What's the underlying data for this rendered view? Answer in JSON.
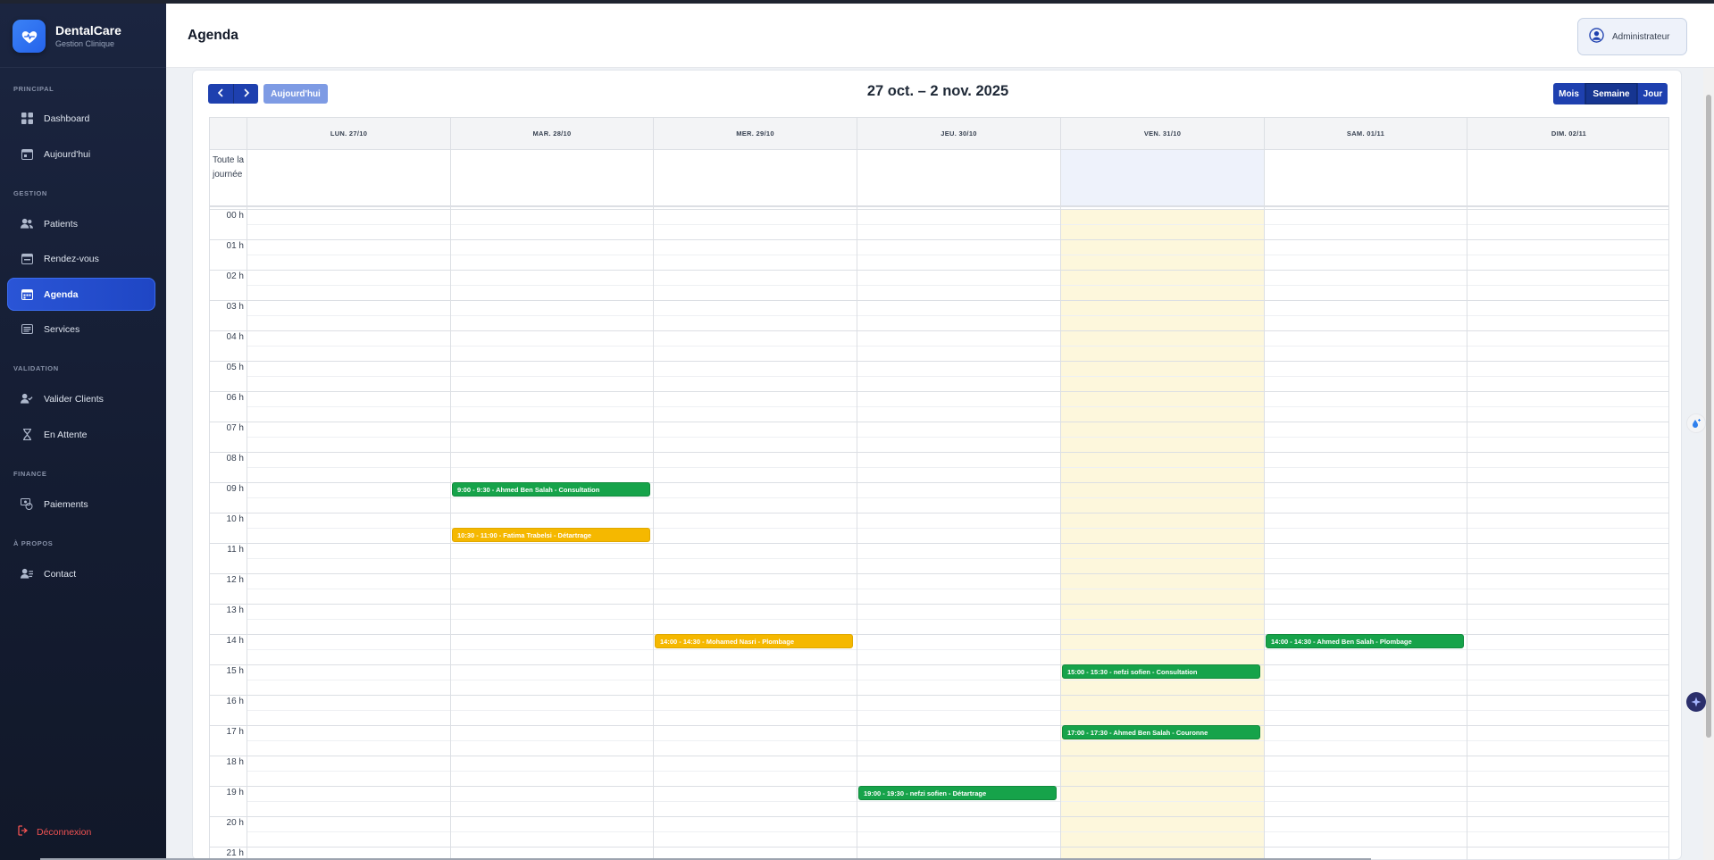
{
  "app": {
    "name": "DentalCare",
    "subtitle": "Gestion Clinique"
  },
  "sidebar": {
    "sections": [
      {
        "label": "PRINCIPAL"
      },
      {
        "label": "GESTION"
      },
      {
        "label": "VALIDATION"
      },
      {
        "label": "FINANCE"
      },
      {
        "label": "À PROPOS"
      }
    ],
    "items": [
      {
        "label": "Dashboard",
        "icon": "grid-icon"
      },
      {
        "label": "Aujourd'hui",
        "icon": "calendar-today-icon"
      },
      {
        "label": "Patients",
        "icon": "users-icon"
      },
      {
        "label": "Rendez-vous",
        "icon": "calendar-check-icon"
      },
      {
        "label": "Agenda",
        "icon": "agenda-icon",
        "active": true
      },
      {
        "label": "Services",
        "icon": "list-icon"
      },
      {
        "label": "Valider Clients",
        "icon": "user-check-icon"
      },
      {
        "label": "En Attente",
        "icon": "hourglass-icon"
      },
      {
        "label": "Paiements",
        "icon": "money-icon"
      },
      {
        "label": "Contact",
        "icon": "contact-icon"
      }
    ],
    "logout_label": "Déconnexion"
  },
  "header": {
    "title": "Agenda",
    "user_label": "Administrateur"
  },
  "calendar": {
    "range_title": "27 oct. – 2 nov. 2025",
    "today_label": "Aujourd'hui",
    "views": [
      {
        "label": "Mois"
      },
      {
        "label": "Semaine",
        "active": true
      },
      {
        "label": "Jour"
      }
    ],
    "allday_label": "Toute la journée",
    "days": [
      {
        "label": "LUN. 27/10"
      },
      {
        "label": "MAR. 28/10"
      },
      {
        "label": "MER. 29/10"
      },
      {
        "label": "JEU. 30/10"
      },
      {
        "label": "VEN. 31/10",
        "today": true
      },
      {
        "label": "SAM. 01/11"
      },
      {
        "label": "DIM. 02/11"
      }
    ],
    "hours": [
      "00 h",
      "01 h",
      "02 h",
      "03 h",
      "04 h",
      "05 h",
      "06 h",
      "07 h",
      "08 h",
      "09 h",
      "10 h",
      "11 h",
      "12 h",
      "13 h",
      "14 h",
      "15 h",
      "16 h",
      "17 h",
      "18 h",
      "19 h",
      "20 h",
      "21 h"
    ],
    "events": [
      {
        "day": 1,
        "start": 9.0,
        "text": "9:00 - 9:30 - Ahmed Ben Salah - Consultation",
        "color": "green"
      },
      {
        "day": 1,
        "start": 10.5,
        "text": "10:30 - 11:00 - Fatima Trabelsi - Détartrage",
        "color": "yellow"
      },
      {
        "day": 2,
        "start": 14.0,
        "text": "14:00 - 14:30 - Mohamed Nasri - Plombage",
        "color": "yellow"
      },
      {
        "day": 5,
        "start": 14.0,
        "text": "14:00 - 14:30 - Ahmed Ben Salah - Plombage",
        "color": "green"
      },
      {
        "day": 4,
        "start": 15.0,
        "text": "15:00 - 15:30 - nefzi sofien - Consultation",
        "color": "green"
      },
      {
        "day": 4,
        "start": 17.0,
        "text": "17:00 - 17:30 - Ahmed Ben Salah - Couronne",
        "color": "green"
      },
      {
        "day": 3,
        "start": 19.0,
        "text": "19:00 - 19:30 - nefzi sofien - Détartrage",
        "color": "green"
      }
    ]
  },
  "colors": {
    "accent": "#1e40af",
    "sidebar_bg": "#172038",
    "event_green": "#16a34a",
    "event_yellow": "#f5b800",
    "today_bg": "#fdf7dc"
  }
}
